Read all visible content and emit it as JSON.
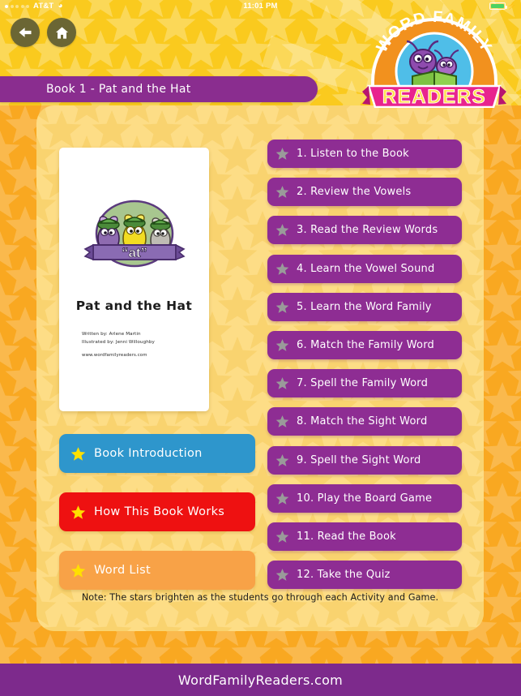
{
  "status_bar": {
    "carrier": "AT&T",
    "time": "11:01 PM",
    "wifi_icon": "wifi-icon",
    "battery_icon": "battery-charging-icon",
    "signal_dots_filled": 1,
    "signal_dots_total": 5
  },
  "header": {
    "back_icon": "back-arrow-icon",
    "home_icon": "home-icon",
    "book_title": "Book 1 - Pat and the Hat",
    "logo": {
      "arch_text": "WORD FAMILY",
      "banner_text": "READERS",
      "arch_color": "#F2911E",
      "circle_color": "#4FBEE8",
      "banner_color": "#E8248E",
      "banner_text_color": "#FFE14D"
    }
  },
  "book_cover": {
    "word_family": "“at”",
    "title": "Pat and the Hat",
    "written_by": "Written by:  Arlene Martin",
    "illustrated_by": "Illustrated by:   Jenni Willoughby",
    "url": "www.wordfamilyreaders.com"
  },
  "side_buttons": [
    {
      "label": "Book Introduction",
      "color": "#2E96CC",
      "star_color": "#FFE000"
    },
    {
      "label": "How This Book Works",
      "color": "#EE1111",
      "star_color": "#FFE000"
    },
    {
      "label": "Word List",
      "color": "#F8A247",
      "star_color": "#FFE000"
    }
  ],
  "activities": [
    {
      "label": "1. Listen to the Book",
      "star_state": "dim"
    },
    {
      "label": "2. Review the Vowels",
      "star_state": "dim"
    },
    {
      "label": "3. Read the Review Words",
      "star_state": "dim"
    },
    {
      "label": "4. Learn the Vowel Sound",
      "star_state": "dim"
    },
    {
      "label": "5. Learn the Word Family",
      "star_state": "dim"
    },
    {
      "label": "6. Match the Family Word",
      "star_state": "dim"
    },
    {
      "label": "7. Spell the Family Word",
      "star_state": "dim"
    },
    {
      "label": "8. Match the Sight Word",
      "star_state": "dim"
    },
    {
      "label": "9. Spell the Sight Word",
      "star_state": "dim"
    },
    {
      "label": "10. Play the Board Game",
      "star_state": "dim"
    },
    {
      "label": "11. Read the Book",
      "star_state": "dim"
    },
    {
      "label": "12. Take the Quiz",
      "star_state": "dim"
    }
  ],
  "note": "Note: The stars brighten as the students go through each Activity and Game.",
  "footer": {
    "site": "WordFamilyReaders.com"
  },
  "colors": {
    "outer_gold": "#F9A821",
    "header_gold": "#FACA1E",
    "inner_cream": "#FDDD86",
    "purple": "#8E2D93",
    "title_purple": "#8A2D8F",
    "footer_purple": "#7D2A8C",
    "dim_star": "#9A9A9A"
  }
}
